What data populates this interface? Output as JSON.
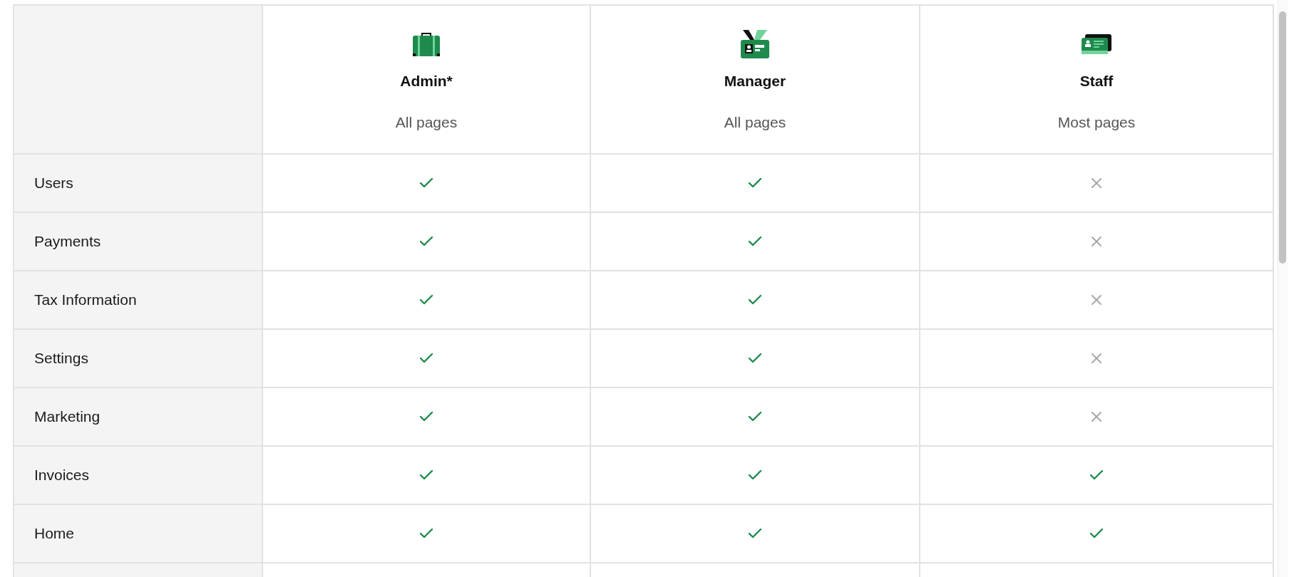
{
  "roles": [
    {
      "kind": "briefcase",
      "name": "Admin*",
      "scope": "All pages"
    },
    {
      "kind": "badge",
      "name": "Manager",
      "scope": "All pages"
    },
    {
      "kind": "card",
      "name": "Staff",
      "scope": "Most pages"
    }
  ],
  "rows": [
    {
      "label": "Users",
      "access": [
        true,
        true,
        false
      ]
    },
    {
      "label": "Payments",
      "access": [
        true,
        true,
        false
      ]
    },
    {
      "label": "Tax Information",
      "access": [
        true,
        true,
        false
      ]
    },
    {
      "label": "Settings",
      "access": [
        true,
        true,
        false
      ]
    },
    {
      "label": "Marketing",
      "access": [
        true,
        true,
        false
      ]
    },
    {
      "label": "Invoices",
      "access": [
        true,
        true,
        true
      ]
    },
    {
      "label": "Home",
      "access": [
        true,
        true,
        true
      ]
    }
  ]
}
